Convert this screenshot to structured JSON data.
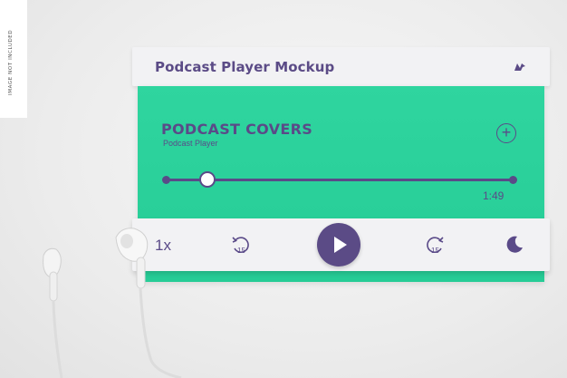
{
  "side_note": "IMAGE NOT INCLUDED",
  "header": {
    "title": "Podcast Player Mockup",
    "logo_icon": "bird-logo-icon"
  },
  "episode": {
    "title": "PODCAST COVERS",
    "subtitle": "Podcast Player",
    "time": "1:49",
    "progress": 0.12
  },
  "controls": {
    "speed": "1x",
    "rewind_label": "15",
    "forward_label": "15",
    "play_icon": "play-icon",
    "sleep_icon": "moon-icon"
  },
  "colors": {
    "accent": "#5b4b86",
    "green": "#2fd59f",
    "panel": "#f2f2f4"
  }
}
